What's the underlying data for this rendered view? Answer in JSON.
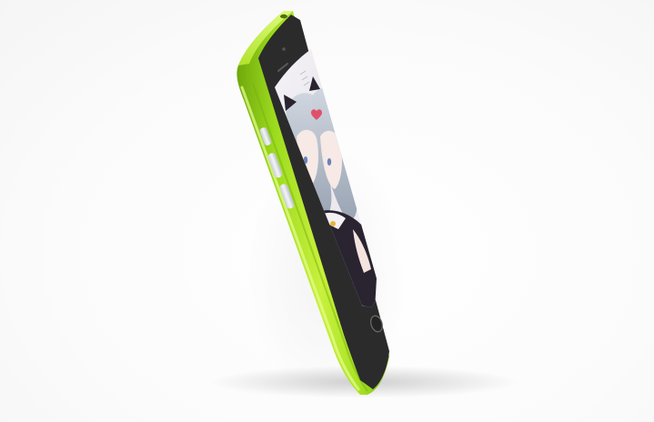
{
  "scene": {
    "subject": "smartphone",
    "colors": {
      "background": "#ffffff",
      "shell": "#9ddb1e",
      "shell_highlight": "#d6f56a",
      "shell_shadow": "#6fa80c",
      "bezel": "#2b2b2b",
      "button": "#dfe4e8",
      "screen_light": "#f2f0f4",
      "hair": "#b9c2cf",
      "outfit": "#2a2330"
    },
    "icons": [
      "home-button-icon",
      "front-camera-icon",
      "speaker-grille-icon",
      "heart-icon"
    ]
  }
}
